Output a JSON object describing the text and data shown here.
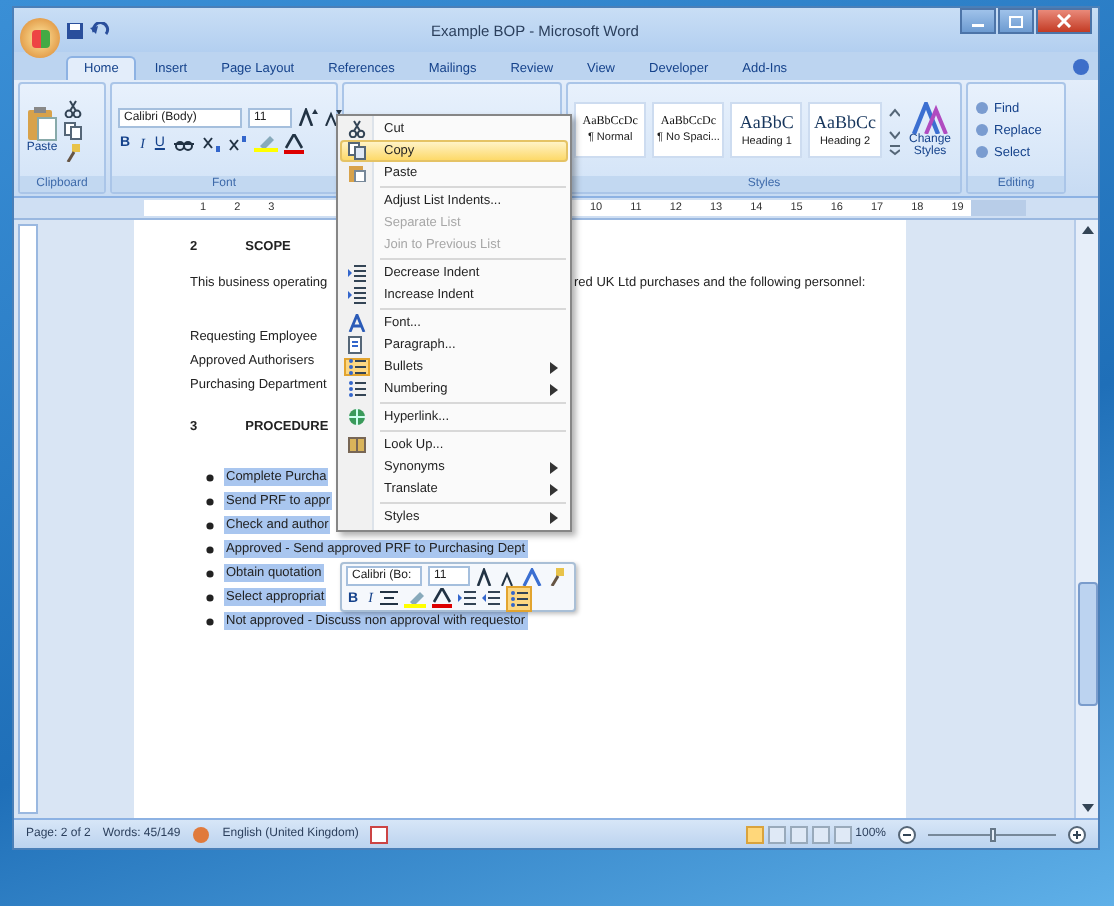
{
  "window": {
    "title": "Example BOP - Microsoft Word"
  },
  "tabs": [
    {
      "label": "Home",
      "selected": true
    },
    {
      "label": "Insert",
      "selected": false
    },
    {
      "label": "Page Layout",
      "selected": false
    },
    {
      "label": "References",
      "selected": false
    },
    {
      "label": "Mailings",
      "selected": false
    },
    {
      "label": "Review",
      "selected": false
    },
    {
      "label": "View",
      "selected": false
    },
    {
      "label": "Developer",
      "selected": false
    },
    {
      "label": "Add-Ins",
      "selected": false
    }
  ],
  "ribbon": {
    "clipboard": {
      "paste": "Paste",
      "label": "Clipboard"
    },
    "font": {
      "family": "Calibri (Body)",
      "size": "11",
      "bold": "B",
      "italic": "I",
      "underline": "U",
      "label": "Font"
    },
    "styles": {
      "label": "Styles",
      "change": "Change Styles",
      "items": [
        {
          "sample": "AaBbCcDc",
          "name": "¶ Normal",
          "kind": "body"
        },
        {
          "sample": "AaBbCcDc",
          "name": "¶ No Spaci...",
          "kind": "body"
        },
        {
          "sample": "AaBbC",
          "name": "Heading 1",
          "kind": "heading"
        },
        {
          "sample": "AaBbCc",
          "name": "Heading 2",
          "kind": "heading"
        }
      ]
    },
    "editing": {
      "label": "Editing",
      "items": [
        "Find",
        "Replace",
        "Select"
      ]
    }
  },
  "ruler": {
    "left_numbers": [
      "1",
      "2",
      "3"
    ],
    "right_numbers": [
      "10",
      "11",
      "12",
      "13",
      "14",
      "15",
      "16",
      "17",
      "18",
      "19"
    ]
  },
  "document": {
    "scope": {
      "number": "2",
      "title": "SCOPE"
    },
    "paragraph_left": "This business operating",
    "paragraph_right": "red UK Ltd purchases and the following personnel:",
    "personnel": [
      "Requesting Employee",
      "Approved Authorisers",
      "Purchasing Department"
    ],
    "procedure": {
      "number": "3",
      "title": "PROCEDURE"
    },
    "bullets": [
      {
        "text": "Complete Purcha",
        "selected": true
      },
      {
        "text": "Send PRF to appr",
        "selected": true
      },
      {
        "text": "Check and author",
        "selected": true
      },
      {
        "text": "Approved - Send approved PRF to Purchasing Dept",
        "selected": true
      },
      {
        "text": "Obtain quotation",
        "selected": true
      },
      {
        "text": "Select appropriat",
        "selected": true
      },
      {
        "text": "Not approved - Discuss non approval with requestor",
        "selected": true
      }
    ]
  },
  "context_menu": {
    "items": [
      {
        "label": "Cut",
        "selected": false,
        "disabled": false,
        "checked": false,
        "submenu": false,
        "separator_before": false
      },
      {
        "label": "Copy",
        "selected": true,
        "disabled": false,
        "checked": false,
        "submenu": false,
        "separator_before": false
      },
      {
        "label": "Paste",
        "selected": false,
        "disabled": false,
        "checked": false,
        "submenu": false,
        "separator_before": false
      },
      {
        "label": "Adjust List Indents...",
        "selected": false,
        "disabled": false,
        "checked": false,
        "submenu": false,
        "separator_before": true
      },
      {
        "label": "Separate List",
        "selected": false,
        "disabled": true,
        "checked": false,
        "submenu": false,
        "separator_before": false
      },
      {
        "label": "Join to Previous List",
        "selected": false,
        "disabled": true,
        "checked": false,
        "submenu": false,
        "separator_before": false
      },
      {
        "label": "Decrease Indent",
        "selected": false,
        "disabled": false,
        "checked": false,
        "submenu": false,
        "separator_before": true
      },
      {
        "label": "Increase Indent",
        "selected": false,
        "disabled": false,
        "checked": false,
        "submenu": false,
        "separator_before": false
      },
      {
        "label": "Font...",
        "selected": false,
        "disabled": false,
        "checked": false,
        "submenu": false,
        "separator_before": true
      },
      {
        "label": "Paragraph...",
        "selected": false,
        "disabled": false,
        "checked": false,
        "submenu": false,
        "separator_before": false
      },
      {
        "label": "Bullets",
        "selected": false,
        "disabled": false,
        "checked": true,
        "submenu": true,
        "separator_before": false
      },
      {
        "label": "Numbering",
        "selected": false,
        "disabled": false,
        "checked": false,
        "submenu": true,
        "separator_before": false
      },
      {
        "label": "Hyperlink...",
        "selected": false,
        "disabled": false,
        "checked": false,
        "submenu": false,
        "separator_before": true
      },
      {
        "label": "Look Up...",
        "selected": false,
        "disabled": false,
        "checked": false,
        "submenu": false,
        "separator_before": true
      },
      {
        "label": "Synonyms",
        "selected": false,
        "disabled": false,
        "checked": false,
        "submenu": true,
        "separator_before": false
      },
      {
        "label": "Translate",
        "selected": false,
        "disabled": false,
        "checked": false,
        "submenu": true,
        "separator_before": false
      },
      {
        "label": "Styles",
        "selected": false,
        "disabled": false,
        "checked": false,
        "submenu": true,
        "separator_before": true
      }
    ]
  },
  "mini_toolbar": {
    "font": "Calibri (Bo:",
    "size": "11",
    "bold": "B",
    "italic": "I",
    "bullets_checked": true
  },
  "status_bar": {
    "page": "Page: 2 of 2",
    "words": "Words: 45/149",
    "language": "English (United Kingdom)",
    "zoom": "100%",
    "level": 0.5
  }
}
